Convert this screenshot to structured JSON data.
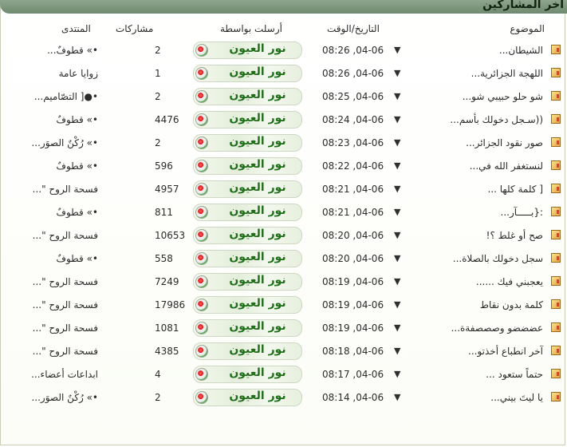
{
  "section_title": "آخر المشاركين",
  "headers": {
    "topic": "الموضوع",
    "datetime": "التاريخ/الوقت",
    "posted_by": "أرسلت بواسطة",
    "posts": "مشاركات",
    "forum": "المنتدى"
  },
  "rows": [
    {
      "topic": "الشيطان...",
      "date": "08:26 ,04-06",
      "user": "نور العيون",
      "posts": "2",
      "forum": "•» قطوفٌ..."
    },
    {
      "topic": "اللهجة الجزائرية...",
      "date": "08:26 ,04-06",
      "user": "نور العيون",
      "posts": "1",
      "forum": "زوايا عامة"
    },
    {
      "topic": "شو حلو حبيبي شو...",
      "date": "08:25 ,04-06",
      "user": "نور العيون",
      "posts": "2",
      "forum": "•●[ التصّاميم..."
    },
    {
      "topic": "((سـجل دخولك بأسم...",
      "date": "08:24 ,04-06",
      "user": "نور العيون",
      "posts": "4476",
      "forum": "•» قطوفٌ"
    },
    {
      "topic": "صور نقود الجزائر...",
      "date": "08:23 ,04-06",
      "user": "نور العيون",
      "posts": "2",
      "forum": "•» رُكْنٌ الصوَر..."
    },
    {
      "topic": "لنستغفر الله في...",
      "date": "08:22 ,04-06",
      "user": "نور العيون",
      "posts": "596",
      "forum": "•» قطوفٌ"
    },
    {
      "topic": "[ كلمة كلها ...",
      "date": "08:21 ,04-06",
      "user": "نور العيون",
      "posts": "4957",
      "forum": "فسحة الروح \"..."
    },
    {
      "topic": ":{بـــــآر...",
      "date": "08:21 ,04-06",
      "user": "نور العيون",
      "posts": "811",
      "forum": "•» قطوفٌ"
    },
    {
      "topic": "صح أو غلط ؟!",
      "date": "08:20 ,04-06",
      "user": "نور العيون",
      "posts": "10653",
      "forum": "فسحة الروح \"..."
    },
    {
      "topic": "سجل دخولك بالصلاة...",
      "date": "08:20 ,04-06",
      "user": "نور العيون",
      "posts": "558",
      "forum": "•» قطوفٌ"
    },
    {
      "topic": "يعجبني فيك ......",
      "date": "08:19 ,04-06",
      "user": "نور العيون",
      "posts": "7249",
      "forum": "فسحة الروح \"..."
    },
    {
      "topic": "كلمة بدون نقاط",
      "date": "08:19 ,04-06",
      "user": "نور العيون",
      "posts": "17986",
      "forum": "فسحة الروح \"..."
    },
    {
      "topic": "عضضضو وصصصفةة...",
      "date": "08:19 ,04-06",
      "user": "نور العيون",
      "posts": "1081",
      "forum": "فسحة الروح \"..."
    },
    {
      "topic": "آخر انطباع أخذتو...",
      "date": "08:18 ,04-06",
      "user": "نور العيون",
      "posts": "4385",
      "forum": "فسحة الروح \"..."
    },
    {
      "topic": "حتماً ستعود ...",
      "date": "08:17 ,04-06",
      "user": "نور العيون",
      "posts": "4",
      "forum": "ابداعات أعضاء..."
    },
    {
      "topic": "يا ليتَ بيني...",
      "date": "08:14 ,04-06",
      "user": "نور العيون",
      "posts": "2",
      "forum": "•» رُكْنٌ الصوَر..."
    }
  ],
  "colors": {
    "title_bar": "#7a937a",
    "username": "#1f6e18",
    "text": "#2b2b2b"
  },
  "icons": {
    "topic": "topic-folder-icon",
    "arrow": "latest-post-arrow-icon",
    "user_flag": "algeria-flag-icon"
  }
}
